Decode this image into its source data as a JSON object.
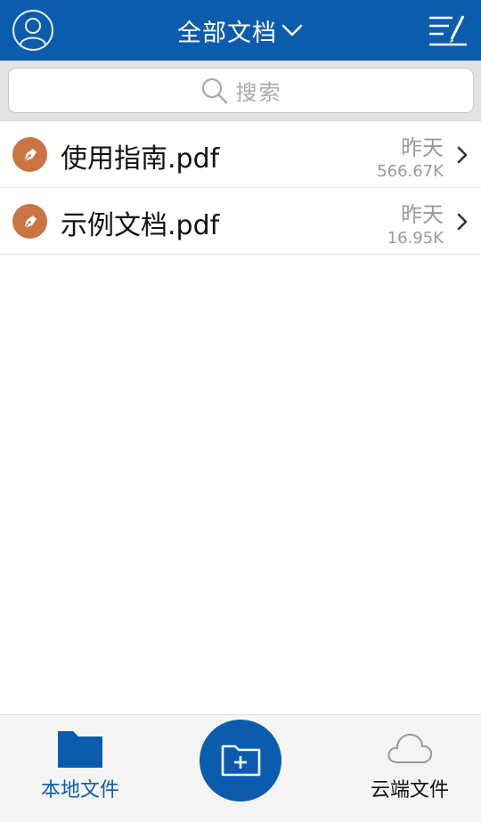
{
  "header": {
    "title": "全部文档",
    "icons": {
      "profile": "user-avatar-icon",
      "dropdown": "chevron-down-icon",
      "edit": "edit-list-icon"
    }
  },
  "search": {
    "placeholder": "搜索",
    "icon": "search-icon"
  },
  "files": [
    {
      "name": "使用指南.pdf",
      "date": "昨天",
      "size": "566.67K",
      "icon": "pen-nib-icon"
    },
    {
      "name": "示例文档.pdf",
      "date": "昨天",
      "size": "16.95K",
      "icon": "pen-nib-icon"
    }
  ],
  "bottom_nav": {
    "local_label": "本地文件",
    "cloud_label": "云端文件",
    "fab_icon": "new-folder-icon"
  },
  "colors": {
    "primary": "#0b5cad",
    "file_icon": "#c97441",
    "secondary_text": "#9a9a9a",
    "search_band": "#e3e3e3"
  }
}
